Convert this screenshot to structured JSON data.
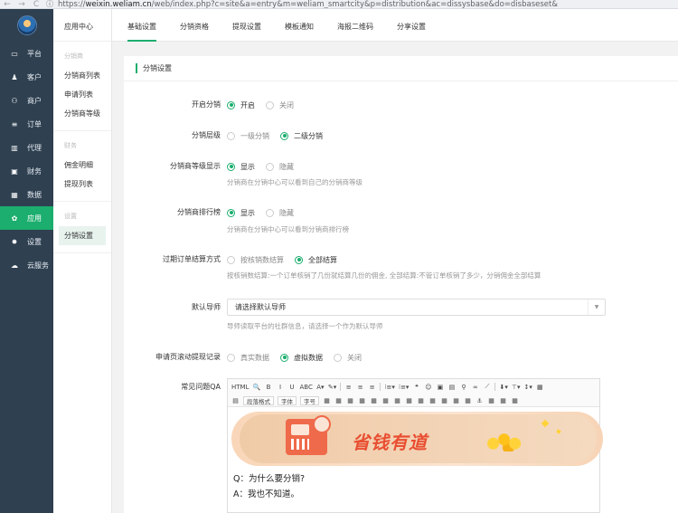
{
  "browser": {
    "back": "←",
    "forward": "→",
    "reload": "C",
    "info": "ⓘ",
    "url_prefix": "https://",
    "url_host": "weixin.weliam.cn",
    "url_path": "/web/index.php?c=site&a=entry&m=weliam_smartcity&p=distribution&ac=dissysbase&do=disbaseset&"
  },
  "sidebar": {
    "items": [
      {
        "icon": "▭",
        "label": "平台"
      },
      {
        "icon": "♟",
        "label": "客户"
      },
      {
        "icon": "⚇",
        "label": "商户"
      },
      {
        "icon": "≡",
        "label": "订单"
      },
      {
        "icon": "▥",
        "label": "代理"
      },
      {
        "icon": "▣",
        "label": "财务"
      },
      {
        "icon": "▦",
        "label": "数据"
      },
      {
        "icon": "✿",
        "label": "应用"
      },
      {
        "icon": "✸",
        "label": "设置"
      },
      {
        "icon": "☁",
        "label": "云服务"
      }
    ],
    "active_index": 7
  },
  "submenu": {
    "title": "应用中心",
    "groups": [
      {
        "head": "分销商",
        "links": [
          "分销商列表",
          "申请列表",
          "分销商等级"
        ]
      },
      {
        "head": "财务",
        "links": [
          "佣金明细",
          "提现列表"
        ]
      },
      {
        "head": "设置",
        "links": [
          "分销设置"
        ]
      }
    ]
  },
  "tabs": [
    "基础设置",
    "分销资格",
    "提现设置",
    "模板通知",
    "海报二维码",
    "分享设置"
  ],
  "section_title": "分销设置",
  "form": {
    "enable": {
      "label": "开启分销",
      "options": [
        "开启",
        "关闭"
      ],
      "selected": 0
    },
    "levels": {
      "label": "分销层级",
      "options": [
        "一级分销",
        "二级分销"
      ],
      "selected": 1
    },
    "level_show": {
      "label": "分销商等级显示",
      "options": [
        "显示",
        "隐藏"
      ],
      "selected": 0,
      "hint": "分销商在分销中心可以看到自己的分销商等级"
    },
    "ranking": {
      "label": "分销商排行榜",
      "options": [
        "显示",
        "隐藏"
      ],
      "selected": 0,
      "hint": "分销商在分销中心可以看到分销商排行榜"
    },
    "expired": {
      "label": "过期订单结算方式",
      "options": [
        "按核销数结算",
        "全部结算"
      ],
      "selected": 1,
      "hint": "按核销数结算:一个订单核销了几份就结算几份的佣金, 全部结算:不管订单核销了多少，分销佣金全部结算"
    },
    "mentor": {
      "label": "默认导师",
      "value": "请选择默认导师",
      "arrow": "▼",
      "hint": "导师读取平台的社群信息，请选择一个作为默认导师"
    },
    "scroll": {
      "label": "申请页滚动提现记录",
      "options": [
        "真实数据",
        "虚拟数据",
        "关闭"
      ],
      "selected": 1
    },
    "qa": {
      "label": "常见问题QA",
      "toolbar_row1": [
        "HTML",
        "🔍",
        "B",
        "I",
        "U",
        "ABC",
        "A▾",
        "✎▾",
        "≡",
        "≡",
        "≡",
        "⁝≡▾",
        "⁝≡▾",
        "❝",
        "☺",
        "▣",
        "▤",
        "⚲",
        "∞",
        "⟋",
        "⬇▾",
        "⊤▾",
        "↕▾",
        "▦"
      ],
      "toolbar_row2": [
        "▤",
        "段落格式",
        "字体",
        "字号",
        "▦",
        "▦",
        "▦",
        "▦",
        "▦",
        "▦",
        "▦",
        "▦",
        "▦",
        "▦",
        "▦",
        "▦",
        "▦",
        "⚓",
        "▦",
        "▦",
        "▦"
      ],
      "banner_text": "省钱有道",
      "lines": [
        "Q：为什么要分销?",
        "A：我也不知道。"
      ]
    }
  },
  "colors": {
    "accent": "#1cae6e",
    "sidebar_bg": "#2f4050"
  }
}
